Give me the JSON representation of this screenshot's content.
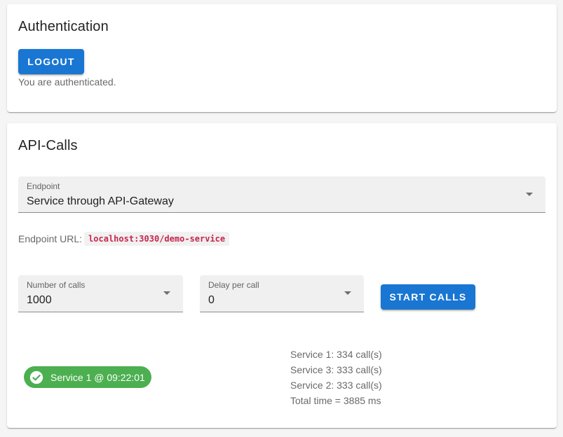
{
  "auth": {
    "title": "Authentication",
    "logout_label": "LOGOUT",
    "status_text": "You are authenticated."
  },
  "api": {
    "title": "API-Calls",
    "endpoint": {
      "label": "Endpoint",
      "value": "Service through API-Gateway"
    },
    "endpoint_url_label": "Endpoint URL:",
    "endpoint_url": "localhost:3030/demo-service",
    "calls": {
      "label": "Number of calls",
      "value": "1000"
    },
    "delay": {
      "label": "Delay per call",
      "value": "0"
    },
    "start_label": "START CALLS",
    "result_chip": "Service 1 @ 09:22:01",
    "stats": [
      "Service 1: 334 call(s)",
      "Service 3: 333 call(s)",
      "Service 2: 333 call(s)",
      "Total time = 3885 ms"
    ]
  },
  "colors": {
    "primary": "#1976d2",
    "success": "#4caf50",
    "code": "#c7254e"
  },
  "icons": {
    "select_arrow": "arrow-drop-down-icon",
    "chip_check": "check-circle-icon"
  }
}
